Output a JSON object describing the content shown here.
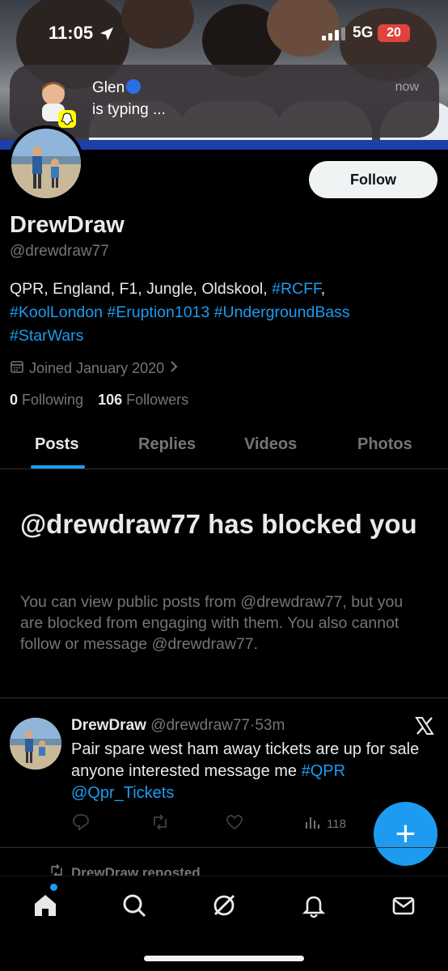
{
  "status_bar": {
    "time": "11:05",
    "network": "5G",
    "battery": "20"
  },
  "notification": {
    "sender": "Glen",
    "message": "is typing ...",
    "time": "now"
  },
  "profile": {
    "follow_label": "Follow",
    "display_name": "DrewDraw",
    "handle": "@drewdraw77",
    "bio_plain_1": "QPR, England, F1, Jungle, Oldskool, ",
    "bio_tags": [
      "#RCFF",
      "#KoolLondon",
      "#Eruption1013",
      "#UndergroundBass",
      "#StarWars"
    ],
    "bio_comma": ",",
    "joined": "Joined January 2020",
    "following_count": "0",
    "following_label": "Following",
    "followers_count": "106",
    "followers_label": "Followers"
  },
  "tabs": [
    {
      "label": "Posts",
      "active": true
    },
    {
      "label": "Replies",
      "active": false
    },
    {
      "label": "Videos",
      "active": false
    },
    {
      "label": "Photos",
      "active": false
    }
  ],
  "blocked": {
    "title": "@drewdraw77 has blocked you",
    "description": "You can view public posts from @drewdraw77, but you are blocked from engaging with them. You also cannot follow or message @drewdraw77."
  },
  "tweet": {
    "author": "DrewDraw",
    "handle": "@drewdraw77",
    "separator": "·",
    "time": "53m",
    "text": "Pair spare west ham away tickets are up for sale anyone interested message me ",
    "hashtag": "#QPR",
    "mention": "@Qpr_Tickets",
    "views": "118"
  },
  "repost": {
    "label": "DrewDraw reposted"
  },
  "fab_label": "+",
  "accent": "#1d9bf0",
  "nav_icons": [
    "home-icon",
    "search-icon",
    "grok-icon",
    "notifications-icon",
    "messages-icon"
  ]
}
